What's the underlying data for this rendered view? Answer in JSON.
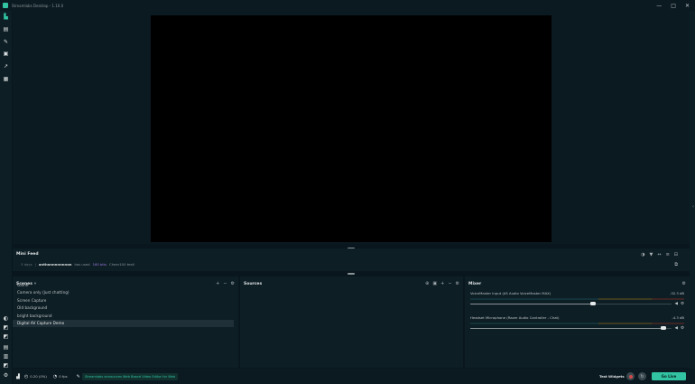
{
  "app": {
    "title": "Streamlabs Desktop - 1.10.0"
  },
  "window_controls": {
    "minimize": "—",
    "maximize": "□",
    "close": "✕"
  },
  "sidebar": {
    "top": [
      {
        "icon": "editor-icon",
        "glyph": "▙"
      },
      {
        "icon": "theme-icon",
        "glyph": "▤"
      },
      {
        "icon": "studio-icon",
        "glyph": "✎"
      },
      {
        "icon": "library-icon",
        "glyph": "▣"
      },
      {
        "icon": "stats-icon",
        "glyph": "↗"
      },
      {
        "icon": "media-icon",
        "glyph": "▦"
      }
    ],
    "bottom": [
      {
        "icon": "help-icon",
        "glyph": "◐"
      },
      {
        "icon": "studio-mode-icon",
        "glyph": "◩"
      },
      {
        "icon": "layout-icon",
        "glyph": "◩"
      },
      {
        "icon": "notifications-icon",
        "glyph": "▤"
      },
      {
        "icon": "settings-list-icon",
        "glyph": "▥"
      },
      {
        "icon": "tools-icon",
        "glyph": "◩"
      },
      {
        "icon": "settings-icon",
        "glyph": "⚙"
      }
    ]
  },
  "mini_feed": {
    "title": "Mini Feed",
    "item": {
      "time": "3 days",
      "separator": "|",
      "user": "anthonnnnnnnon",
      "action": "has used",
      "amount": "160 bits",
      "note": "Cheer100 test!"
    },
    "tools": [
      "◑",
      "▼",
      "↔",
      "≡",
      "⊟"
    ],
    "popout": "⧉"
  },
  "scenes": {
    "title": "Scenes",
    "title_suffix": "▾",
    "tools": [
      "+",
      "−",
      "⚙"
    ],
    "items": [
      "Game",
      "Camera only (Just chatting)",
      "Screen Capture",
      "Old background",
      "bright background",
      "Digital AV Capture Demo"
    ],
    "selected_index": 5
  },
  "sources": {
    "title": "Sources",
    "tools": [
      "⊕",
      "▣",
      "+",
      "−",
      "⚙"
    ]
  },
  "mixer": {
    "title": "Mixer",
    "tool": "⚙",
    "channels": [
      {
        "name": "VoiceMaster Input (AS Audio VoiceMaster MAX)",
        "db": "-32.3 dB",
        "volume": 0.61
      },
      {
        "name": "Headset Microphone (Razer Audio Controller - Chat)",
        "db": "-4.3 dB",
        "volume": 0.96
      }
    ]
  },
  "footer": {
    "cpu_icon": "▟",
    "cpu": "0.20 (0%)",
    "fps_icon": "◔",
    "fps": "0 fps",
    "promo_icon": "✎",
    "promo": "Streamlabs announces Web Based Video Editor for Web",
    "test_widgets": "Test Widgets",
    "replay_icon": "↻",
    "go_live": "Go Live"
  },
  "colors": {
    "accent": "#31c3a2",
    "background": "#09161d",
    "panel": "#0d1e25"
  }
}
